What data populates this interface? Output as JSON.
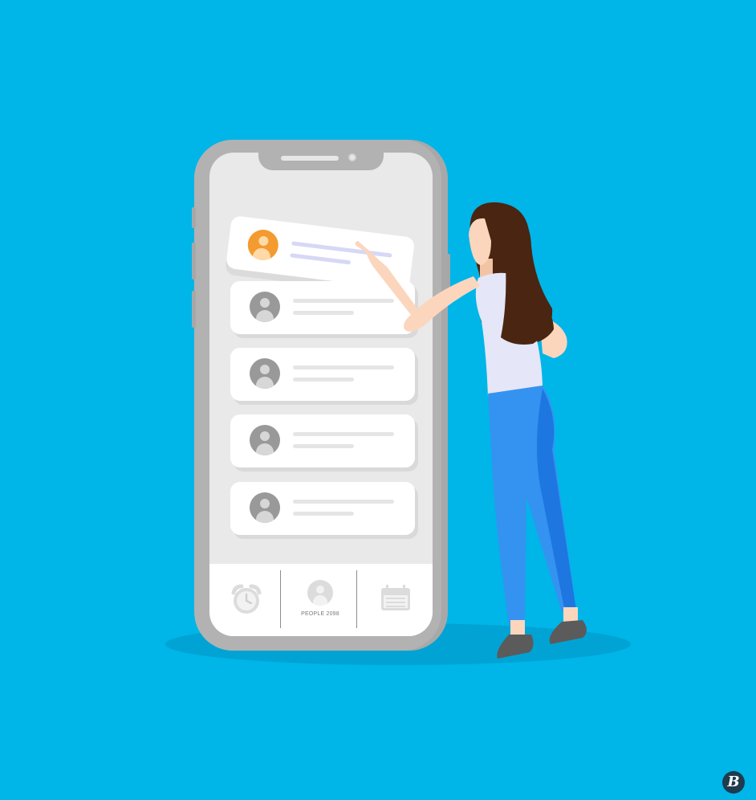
{
  "illustration": {
    "background_color": "#00b5e8",
    "phone": {
      "body_color": "#b2b2b2",
      "screen_color": "#e9e9e9",
      "cards": [
        {
          "highlighted": true,
          "avatar_color": "#f39b2f",
          "avatar_icon": "user-icon"
        },
        {
          "highlighted": false,
          "avatar_color": "#999999",
          "avatar_icon": "user-icon"
        },
        {
          "highlighted": false,
          "avatar_color": "#999999",
          "avatar_icon": "user-icon"
        },
        {
          "highlighted": false,
          "avatar_color": "#999999",
          "avatar_icon": "user-icon"
        },
        {
          "highlighted": false,
          "avatar_color": "#999999",
          "avatar_icon": "user-icon"
        }
      ],
      "tab_bar": {
        "tabs": [
          {
            "icon": "alarm-clock-icon",
            "label": ""
          },
          {
            "icon": "user-icon",
            "label": "PEOPLE 2098"
          },
          {
            "icon": "calendar-icon",
            "label": ""
          }
        ]
      }
    },
    "woman": {
      "hair_color": "#4a2511",
      "top_color": "#e5e6f7",
      "pants_color": "#3493f0",
      "skin_color": "#fbd6bd",
      "shoe_color": "#5b5b5b"
    },
    "watermark": "B"
  }
}
